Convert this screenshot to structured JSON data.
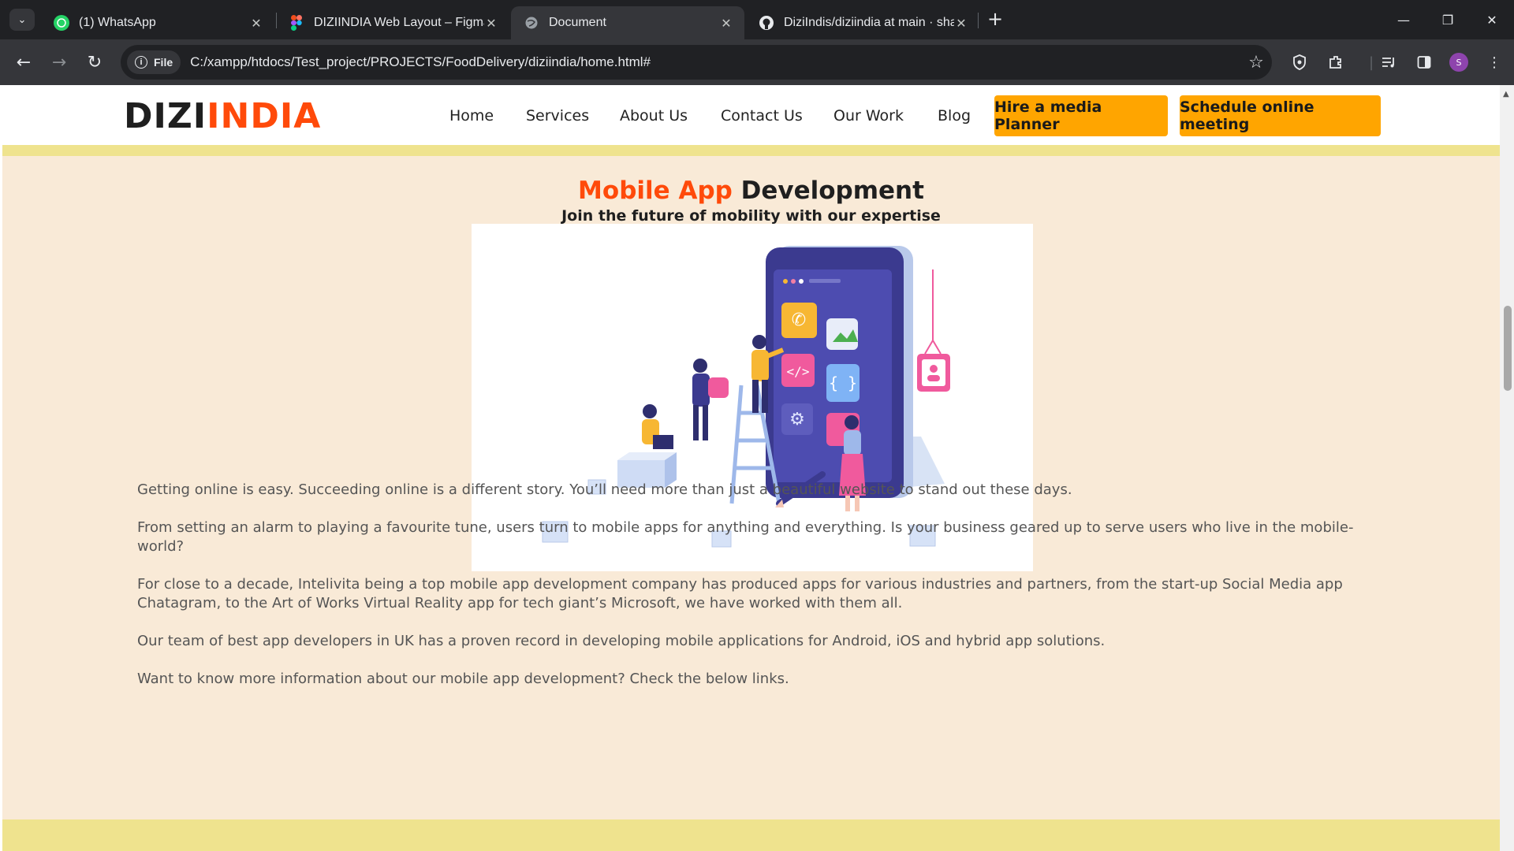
{
  "browser": {
    "tabs": [
      {
        "title": "(1) WhatsApp",
        "icon": "whatsapp-icon",
        "active": false
      },
      {
        "title": "DIZIINDIA Web Layout – Figma",
        "icon": "figma-icon",
        "active": false
      },
      {
        "title": "Document",
        "icon": "globe-icon",
        "active": true
      },
      {
        "title": "DiziIndis/diziindia at main · shar",
        "icon": "github-icon",
        "active": false
      }
    ],
    "file_chip": "File",
    "url": "C:/xampp/htdocs/Test_project/PROJECTS/FoodDelivery/diziindia/home.html#",
    "profile_initial": "S"
  },
  "site": {
    "logo_part1": "DIZI",
    "logo_part2": "INDIA",
    "nav": [
      "Home",
      "Services",
      "About Us",
      "Contact Us",
      "Our Work",
      "Blog"
    ],
    "cta_primary": "Hire a media Planner",
    "cta_secondary": "Schedule online meeting",
    "heading_highlight": "Mobile App",
    "heading_rest": "Development",
    "subheading": "Join the future of mobility with our expertise",
    "paragraphs": [
      "Getting online is easy. Succeeding online is a different story. You’ll need more than just a beautiful website to stand out these days.",
      "From setting an alarm to playing a favourite tune, users turn to mobile apps for anything and everything. Is your business geared up to serve users who live in the mobile-world?",
      "For close to a decade, Intelivita being a top mobile app development company has produced apps for various industries and partners, from the start-up Social Media app Chatagram, to the Art of Works Virtual Reality app for tech giant’s Microsoft, we have worked with them all.",
      "Our team of best app developers in UK has a proven record in developing mobile applications for Android, iOS and hybrid app solutions.",
      "Want to know more information about our mobile app development? Check the below links."
    ]
  },
  "colors": {
    "brand_orange": "#ff4a0a",
    "cta_orange": "#ffa500",
    "page_bg": "#f9ead7",
    "band_yellow": "#efe38e"
  }
}
